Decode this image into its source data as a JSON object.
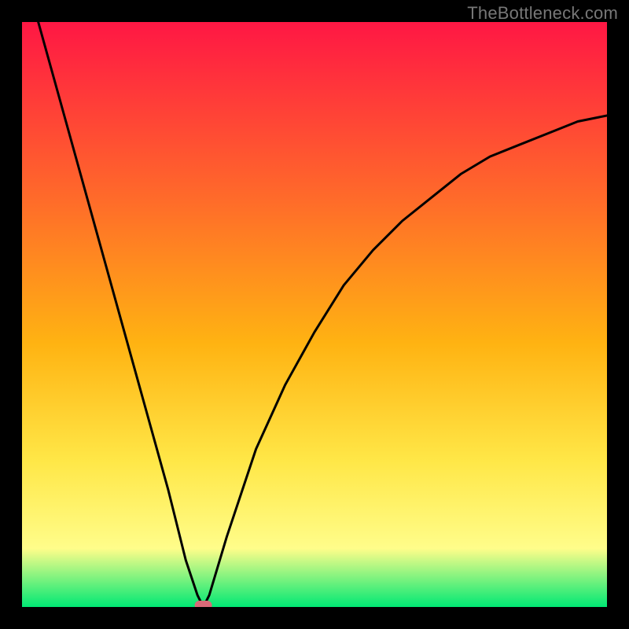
{
  "watermark": "TheBottleneck.com",
  "colors": {
    "top": "#ff1744",
    "mid1": "#ff6a2a",
    "mid2": "#ffb312",
    "mid3": "#ffe747",
    "mid4": "#fffd8a",
    "bottom": "#00e874",
    "curve": "#000000",
    "marker": "#d96a78"
  },
  "chart_data": {
    "type": "line",
    "title": "",
    "xlabel": "",
    "ylabel": "",
    "xlim": [
      0,
      100
    ],
    "ylim": [
      0,
      100
    ],
    "series": [
      {
        "name": "bottleneck-curve",
        "x": [
          0,
          5,
          10,
          15,
          20,
          25,
          28,
          30,
          31,
          32,
          35,
          40,
          45,
          50,
          55,
          60,
          65,
          70,
          75,
          80,
          85,
          90,
          95,
          100
        ],
        "values": [
          110,
          92,
          74,
          56,
          38,
          20,
          8,
          2,
          0,
          2,
          12,
          27,
          38,
          47,
          55,
          61,
          66,
          70,
          74,
          77,
          79,
          81,
          83,
          84
        ]
      }
    ],
    "marker": {
      "x": 31,
      "y": 0
    }
  }
}
